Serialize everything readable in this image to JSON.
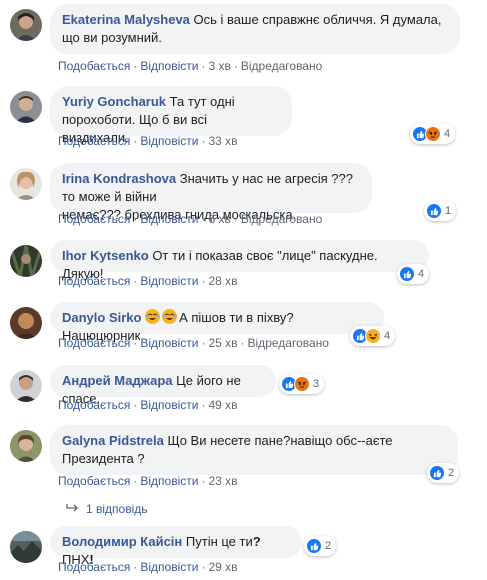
{
  "comments": [
    {
      "name": "Ekaterina Malysheva",
      "text_line1": "Ось і ваше справжнє обличчя. Я думала,",
      "text_line2": "що ви розумний.",
      "like": "Подобається",
      "reply": "Відповісти",
      "time": "3 хв",
      "edited": "Відредаговано"
    },
    {
      "name": "Yuriy Goncharuk",
      "text_line1": "Та тут одні порохоботи. Що б ви всі",
      "text_line2": "виздихали.",
      "like": "Подобається",
      "reply": "Відповісти",
      "time": "33 хв",
      "reaction_count": "4"
    },
    {
      "name": "Irina Kondrashova",
      "text_line1": "Значить у нас не агресія ???то може й війни",
      "text_line2": "немає??? брехлива гнида москальска.",
      "like": "Подобається",
      "reply": "Відповісти",
      "time": "6 хв",
      "edited": "Відредаговано",
      "reaction_count": "1"
    },
    {
      "name": "Ihor Kytsenko",
      "text": "От ти і показав своє \"лице\" паскудне. Дякую!",
      "like": "Подобається",
      "reply": "Відповісти",
      "time": "28 хв",
      "reaction_count": "4"
    },
    {
      "name": "Danylo Sirko",
      "text": "А пішов ти в піхву? Нацюцюрник",
      "like": "Подобається",
      "reply": "Відповісти",
      "time": "25 хв",
      "edited": "Відредаговано",
      "reaction_count": "4"
    },
    {
      "name": "Андрей Маджара",
      "text": "Це його не спасе.",
      "like": "Подобається",
      "reply": "Відповісти",
      "time": "49 хв",
      "reaction_count": "3"
    },
    {
      "name": "Galyna Pidstrela",
      "text_line1": "Що Ви несете пане?навіщо обс--аєте",
      "text_line2": "Президента ?",
      "like": "Подобається",
      "reply": "Відповісти",
      "time": "23 хв",
      "reaction_count": "2",
      "replies_label": "1 відповідь"
    },
    {
      "name": "Володимир Кайсін",
      "text": "Путін це ти",
      "text_b": "ПНХ",
      "like": "Подобається",
      "reply": "Відповісти",
      "time": "29 хв",
      "reaction_count": "2"
    }
  ],
  "separator": "·",
  "colors": {
    "name": "#385898",
    "bubble": "#f2f3f5",
    "meta": "#606770",
    "like": "#1877f2",
    "angry": "#e9710f",
    "haha": "#f7b125"
  },
  "icons": [
    "like-icon",
    "angry-icon",
    "haha-icon",
    "reply-arrow-icon"
  ]
}
